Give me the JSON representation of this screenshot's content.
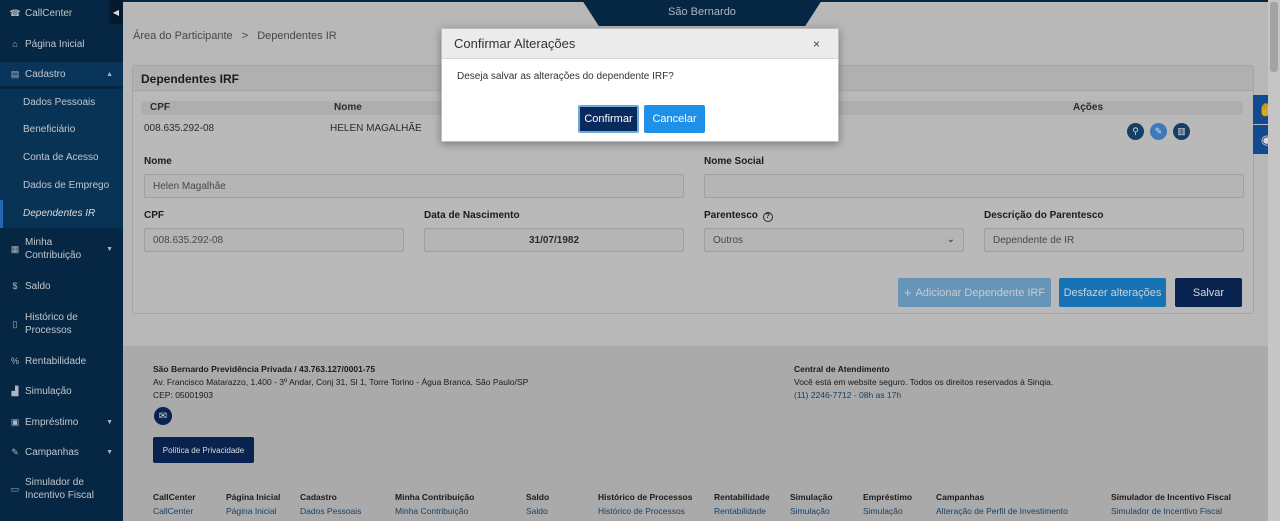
{
  "sidebar": {
    "items": [
      {
        "icon": "headset-icon",
        "glyph": "☎",
        "label": "CallCenter"
      },
      {
        "icon": "home-icon",
        "glyph": "⌂",
        "label": "Página Inicial"
      },
      {
        "icon": "id-card-icon",
        "glyph": "▤",
        "label": "Cadastro"
      },
      {
        "icon": "calculator-icon",
        "glyph": "▦",
        "label": "Minha Contribuição"
      },
      {
        "icon": "dollar-icon",
        "glyph": "$",
        "label": "Saldo"
      },
      {
        "icon": "document-icon",
        "glyph": "▯",
        "label": "Histórico de Processos"
      },
      {
        "icon": "percent-icon",
        "glyph": "%",
        "label": "Rentabilidade"
      },
      {
        "icon": "chart-icon",
        "glyph": "▟",
        "label": "Simulação"
      },
      {
        "icon": "briefcase-icon",
        "glyph": "▣",
        "label": "Empréstimo"
      },
      {
        "icon": "edit-icon",
        "glyph": "✎",
        "label": "Campanhas"
      },
      {
        "icon": "money-icon",
        "glyph": "▭",
        "label": "Simulador de Incentivo Fiscal"
      }
    ],
    "sub": [
      "Dados Pessoais",
      "Beneficiário",
      "Conta de Acesso",
      "Dados de Emprego",
      "Dependentes IR"
    ]
  },
  "brand": "São Bernardo",
  "breadcrumb": {
    "root": "Área do Participante",
    "sep": ">",
    "current": "Dependentes IR"
  },
  "card": {
    "title": "Dependentes IRF",
    "headers": {
      "cpf": "CPF",
      "nome": "Nome",
      "acoes": "Ações"
    },
    "row": {
      "cpf": "008.635.292-08",
      "nome": "HELEN MAGALHÃE"
    }
  },
  "form": {
    "nome_label": "Nome",
    "nome_value": "Helen Magalhãe",
    "nome_social_label": "Nome Social",
    "nome_social_value": "",
    "cpf_label": "CPF",
    "cpf_value": "008.635.292-08",
    "nasc_label": "Data de Nascimento",
    "nasc_value": "31/07/1982",
    "parentesco_label": "Parentesco",
    "parentesco_value": "Outros",
    "desc_label": "Descrição do Parentesco",
    "desc_value": "Dependente de IR"
  },
  "buttons": {
    "add": "Adicionar Dependente IRF",
    "undo": "Desfazer alterações",
    "save": "Salvar"
  },
  "footer": {
    "company": "São Bernardo Previdência Privada / 43.763.127/0001-75",
    "address": "Av. Francisco Matarazzo, 1.400 - 3º Andar, Conj 31, Sl 1, Torre Torino - Água Branca, São Paulo/SP",
    "cep": "CEP: 05001903",
    "privacy": "Política de Privacidade",
    "central_title": "Central de Atendimento",
    "central_text": "Você está em website seguro. Todos os direitos reservados à Sinqia.",
    "phone": "(11) 2246-7712 - 08h as 17h",
    "columns": [
      {
        "title": "CallCenter",
        "link": "CallCenter"
      },
      {
        "title": "Página Inicial",
        "link": "Página Inicial"
      },
      {
        "title": "Cadastro",
        "link": "Dados Pessoais"
      },
      {
        "title": "Minha Contribuição",
        "link": "Minha Contribuição"
      },
      {
        "title": "Saldo",
        "link": "Saldo"
      },
      {
        "title": "Histórico de Processos",
        "link": "Histórico de Processos"
      },
      {
        "title": "Rentabilidade",
        "link": "Rentabilidade"
      },
      {
        "title": "Simulação",
        "link": "Simulação"
      },
      {
        "title": "Empréstimo",
        "link": "Simulação"
      },
      {
        "title": "Campanhas",
        "link": "Alteração de Perfil de Investimento"
      },
      {
        "title": "Simulador de Incentivo Fiscal",
        "link": "Simulador de Incentivo Fiscal"
      }
    ]
  },
  "modal": {
    "title": "Confirmar Alterações",
    "close": "×",
    "message": "Deseja salvar as alterações do dependente IRF?",
    "confirm": "Confirmar",
    "cancel": "Cancelar"
  },
  "colors": {
    "sidebar": "#072e4f",
    "primary": "#0a2a5e",
    "accent": "#1e90e8"
  }
}
